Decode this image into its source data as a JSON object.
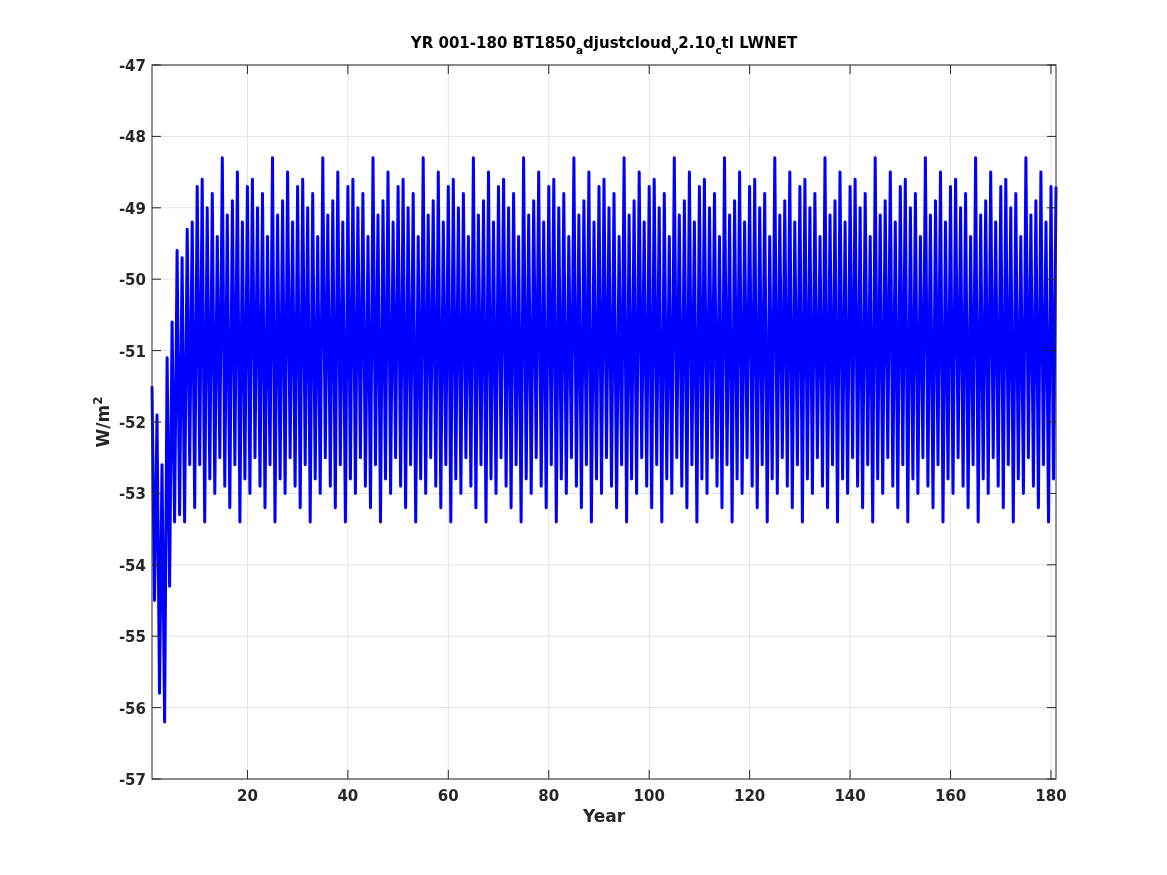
{
  "figure": {
    "chart_data": {
      "type": "line",
      "grid": true,
      "title": "YR 001-180 BT1850$_{a}$djustcloud$_{v}$2.10$_{c}$tl LWNET",
      "xlabel": "Year",
      "ylabel": "W/m$^{2}$",
      "xlim": [
        1,
        181
      ],
      "ylim": [
        -57,
        -47
      ],
      "xticks": [
        20,
        40,
        60,
        80,
        100,
        120,
        140,
        160,
        180
      ],
      "yticks": [
        -57,
        -56,
        -55,
        -54,
        -53,
        -52,
        -51,
        -50,
        -49,
        -48,
        -47
      ],
      "x": [
        1,
        1.5,
        2,
        2.5,
        3,
        3.5,
        4,
        4.5,
        5,
        5.5,
        6,
        6.5,
        7,
        7.5,
        8,
        8.5,
        9,
        9.5,
        10,
        10.5,
        11,
        11.5,
        12,
        12.5,
        13,
        13.5,
        14,
        14.5,
        15,
        15.5,
        16,
        16.5,
        17,
        17.5,
        18,
        18.5,
        19,
        19.5,
        20,
        20.5,
        21,
        21.5,
        22,
        22.5,
        23,
        23.5,
        24,
        24.5,
        25,
        25.5,
        26,
        26.5,
        27,
        27.5,
        28,
        28.5,
        29,
        29.5,
        30,
        30.5,
        31,
        31.5,
        32,
        32.5,
        33,
        33.5,
        34,
        34.5,
        35,
        35.5,
        36,
        36.5,
        37,
        37.5,
        38,
        38.5,
        39,
        39.5,
        40,
        40.5,
        41,
        41.5,
        42,
        42.5,
        43,
        43.5,
        44,
        44.5,
        45,
        45.5,
        46,
        46.5,
        47,
        47.5,
        48,
        48.5,
        49,
        49.5,
        50,
        50.5,
        51,
        51.5,
        52,
        52.5,
        53,
        53.5,
        54,
        54.5,
        55,
        55.5,
        56,
        56.5,
        57,
        57.5,
        58,
        58.5,
        59,
        59.5,
        60,
        60.5,
        61,
        61.5,
        62,
        62.5,
        63,
        63.5,
        64,
        64.5,
        65,
        65.5,
        66,
        66.5,
        67,
        67.5,
        68,
        68.5,
        69,
        69.5,
        70,
        70.5,
        71,
        71.5,
        72,
        72.5,
        73,
        73.5,
        74,
        74.5,
        75,
        75.5,
        76,
        76.5,
        77,
        77.5,
        78,
        78.5,
        79,
        79.5,
        80,
        80.5,
        81,
        81.5,
        82,
        82.5,
        83,
        83.5,
        84,
        84.5,
        85,
        85.5,
        86,
        86.5,
        87,
        87.5,
        88,
        88.5,
        89,
        89.5,
        90,
        90.5,
        91,
        91.5,
        92,
        92.5,
        93,
        93.5,
        94,
        94.5,
        95,
        95.5,
        96,
        96.5,
        97,
        97.5,
        98,
        98.5,
        99,
        99.5,
        100,
        100.5,
        101,
        101.5,
        102,
        102.5,
        103,
        103.5,
        104,
        104.5,
        105,
        105.5,
        106,
        106.5,
        107,
        107.5,
        108,
        108.5,
        109,
        109.5,
        110,
        110.5,
        111,
        111.5,
        112,
        112.5,
        113,
        113.5,
        114,
        114.5,
        115,
        115.5,
        116,
        116.5,
        117,
        117.5,
        118,
        118.5,
        119,
        119.5,
        120,
        120.5,
        121,
        121.5,
        122,
        122.5,
        123,
        123.5,
        124,
        124.5,
        125,
        125.5,
        126,
        126.5,
        127,
        127.5,
        128,
        128.5,
        129,
        129.5,
        130,
        130.5,
        131,
        131.5,
        132,
        132.5,
        133,
        133.5,
        134,
        134.5,
        135,
        135.5,
        136,
        136.5,
        137,
        137.5,
        138,
        138.5,
        139,
        139.5,
        140,
        140.5,
        141,
        141.5,
        142,
        142.5,
        143,
        143.5,
        144,
        144.5,
        145,
        145.5,
        146,
        146.5,
        147,
        147.5,
        148,
        148.5,
        149,
        149.5,
        150,
        150.5,
        151,
        151.5,
        152,
        152.5,
        153,
        153.5,
        154,
        154.5,
        155,
        155.5,
        156,
        156.5,
        157,
        157.5,
        158,
        158.5,
        159,
        159.5,
        160,
        160.5,
        161,
        161.5,
        162,
        162.5,
        163,
        163.5,
        164,
        164.5,
        165,
        165.5,
        166,
        166.5,
        167,
        167.5,
        168,
        168.5,
        169,
        169.5,
        170,
        170.5,
        171,
        171.5,
        172,
        172.5,
        173,
        173.5,
        174,
        174.5,
        175,
        175.5,
        176,
        176.5,
        177,
        177.5,
        178,
        178.5,
        179,
        179.5,
        180,
        180.5,
        181
      ],
      "series": [
        {
          "color": "#0000ff",
          "values": [
            -51.5,
            -54.5,
            -51.9,
            -55.8,
            -52.6,
            -56.2,
            -51.1,
            -54.3,
            -50.6,
            -53.4,
            -49.6,
            -53.3,
            -49.7,
            -53.4,
            -49.3,
            -52.6,
            -49.2,
            -53.2,
            -48.7,
            -52.6,
            -48.6,
            -53.4,
            -49.0,
            -52.8,
            -48.8,
            -53.0,
            -49.4,
            -52.5,
            -48.3,
            -52.9,
            -49.1,
            -53.2,
            -48.9,
            -52.6,
            -48.5,
            -53.4,
            -49.2,
            -52.8,
            -48.7,
            -53.0,
            -48.6,
            -52.5,
            -49.0,
            -52.9,
            -48.8,
            -53.2,
            -49.4,
            -52.6,
            -48.3,
            -53.4,
            -49.1,
            -52.8,
            -48.9,
            -53.0,
            -48.5,
            -52.5,
            -49.2,
            -52.9,
            -48.7,
            -53.2,
            -48.6,
            -52.6,
            -49.0,
            -53.4,
            -48.8,
            -52.8,
            -49.4,
            -53.0,
            -48.3,
            -52.5,
            -49.1,
            -52.9,
            -48.9,
            -53.2,
            -48.5,
            -52.6,
            -49.2,
            -53.4,
            -48.7,
            -52.8,
            -48.6,
            -53.0,
            -49.0,
            -52.5,
            -48.8,
            -52.9,
            -49.4,
            -53.2,
            -48.3,
            -52.6,
            -49.1,
            -53.4,
            -48.9,
            -52.8,
            -48.5,
            -53.0,
            -49.2,
            -52.5,
            -48.7,
            -52.9,
            -48.6,
            -53.2,
            -49.0,
            -52.6,
            -48.8,
            -53.4,
            -49.4,
            -52.8,
            -48.3,
            -53.0,
            -49.1,
            -52.5,
            -48.9,
            -52.9,
            -48.5,
            -53.2,
            -49.2,
            -52.6,
            -48.7,
            -53.4,
            -48.6,
            -52.8,
            -49.0,
            -53.0,
            -48.8,
            -52.5,
            -49.4,
            -52.9,
            -48.3,
            -53.2,
            -49.1,
            -52.6,
            -48.9,
            -53.4,
            -48.5,
            -52.8,
            -49.2,
            -53.0,
            -48.7,
            -52.5,
            -48.6,
            -52.9,
            -49.0,
            -53.2,
            -48.8,
            -52.6,
            -49.4,
            -53.4,
            -48.3,
            -52.8,
            -49.1,
            -53.0,
            -48.9,
            -52.5,
            -48.5,
            -52.9,
            -49.2,
            -53.2,
            -48.7,
            -52.6,
            -48.6,
            -53.4,
            -49.0,
            -52.8,
            -48.8,
            -53.0,
            -49.4,
            -52.5,
            -48.3,
            -52.9,
            -49.1,
            -53.2,
            -48.9,
            -52.6,
            -48.5,
            -53.4,
            -49.2,
            -52.8,
            -48.7,
            -53.0,
            -48.6,
            -52.5,
            -49.0,
            -52.9,
            -48.8,
            -53.2,
            -49.4,
            -52.6,
            -48.3,
            -53.4,
            -49.1,
            -52.8,
            -48.9,
            -53.0,
            -48.5,
            -52.5,
            -49.2,
            -52.9,
            -48.7,
            -53.2,
            -48.6,
            -52.6,
            -49.0,
            -53.4,
            -48.8,
            -52.8,
            -49.4,
            -53.0,
            -48.3,
            -52.5,
            -49.1,
            -52.9,
            -48.9,
            -53.2,
            -48.5,
            -52.6,
            -49.2,
            -53.4,
            -48.7,
            -52.8,
            -48.6,
            -53.0,
            -49.0,
            -52.5,
            -48.8,
            -52.9,
            -49.4,
            -53.2,
            -48.3,
            -52.6,
            -49.1,
            -53.4,
            -48.9,
            -52.8,
            -48.5,
            -53.0,
            -49.2,
            -52.5,
            -48.7,
            -52.9,
            -48.6,
            -53.2,
            -49.0,
            -52.6,
            -48.8,
            -53.4,
            -49.4,
            -52.8,
            -48.3,
            -53.0,
            -49.1,
            -52.5,
            -48.9,
            -52.9,
            -48.5,
            -53.2,
            -49.2,
            -52.6,
            -48.7,
            -53.4,
            -48.6,
            -52.8,
            -49.0,
            -53.0,
            -48.8,
            -52.5,
            -49.4,
            -52.9,
            -48.3,
            -53.2,
            -49.1,
            -52.6,
            -48.9,
            -53.4,
            -48.5,
            -52.8,
            -49.2,
            -53.0,
            -48.7,
            -52.5,
            -48.6,
            -52.9,
            -49.0,
            -53.2,
            -48.8,
            -52.6,
            -49.4,
            -53.4,
            -48.3,
            -52.8,
            -49.1,
            -53.0,
            -48.9,
            -52.5,
            -48.5,
            -52.9,
            -49.2,
            -53.2,
            -48.7,
            -52.6,
            -48.6,
            -53.4,
            -49.0,
            -52.8,
            -48.8,
            -53.0,
            -49.4,
            -52.5,
            -48.3,
            -52.9,
            -49.1,
            -53.2,
            -48.9,
            -52.6,
            -48.5,
            -53.4,
            -49.2,
            -52.8,
            -48.7,
            -53.0,
            -48.6,
            -52.5,
            -49.0,
            -52.9,
            -48.8,
            -53.2,
            -49.4,
            -52.6,
            -48.3,
            -53.4,
            -49.1,
            -52.8,
            -48.9,
            -53.0,
            -48.5,
            -52.5,
            -49.2,
            -52.9,
            -48.7,
            -53.2,
            -48.6,
            -52.6,
            -49.0,
            -53.4,
            -48.8,
            -52.8,
            -49.4,
            -53.0,
            -48.3,
            -52.5,
            -49.1,
            -52.9,
            -48.9,
            -53.2,
            -48.5,
            -52.6,
            -49.2,
            -53.4,
            -48.7,
            -52.8,
            -48.7
          ]
        }
      ]
    }
  }
}
